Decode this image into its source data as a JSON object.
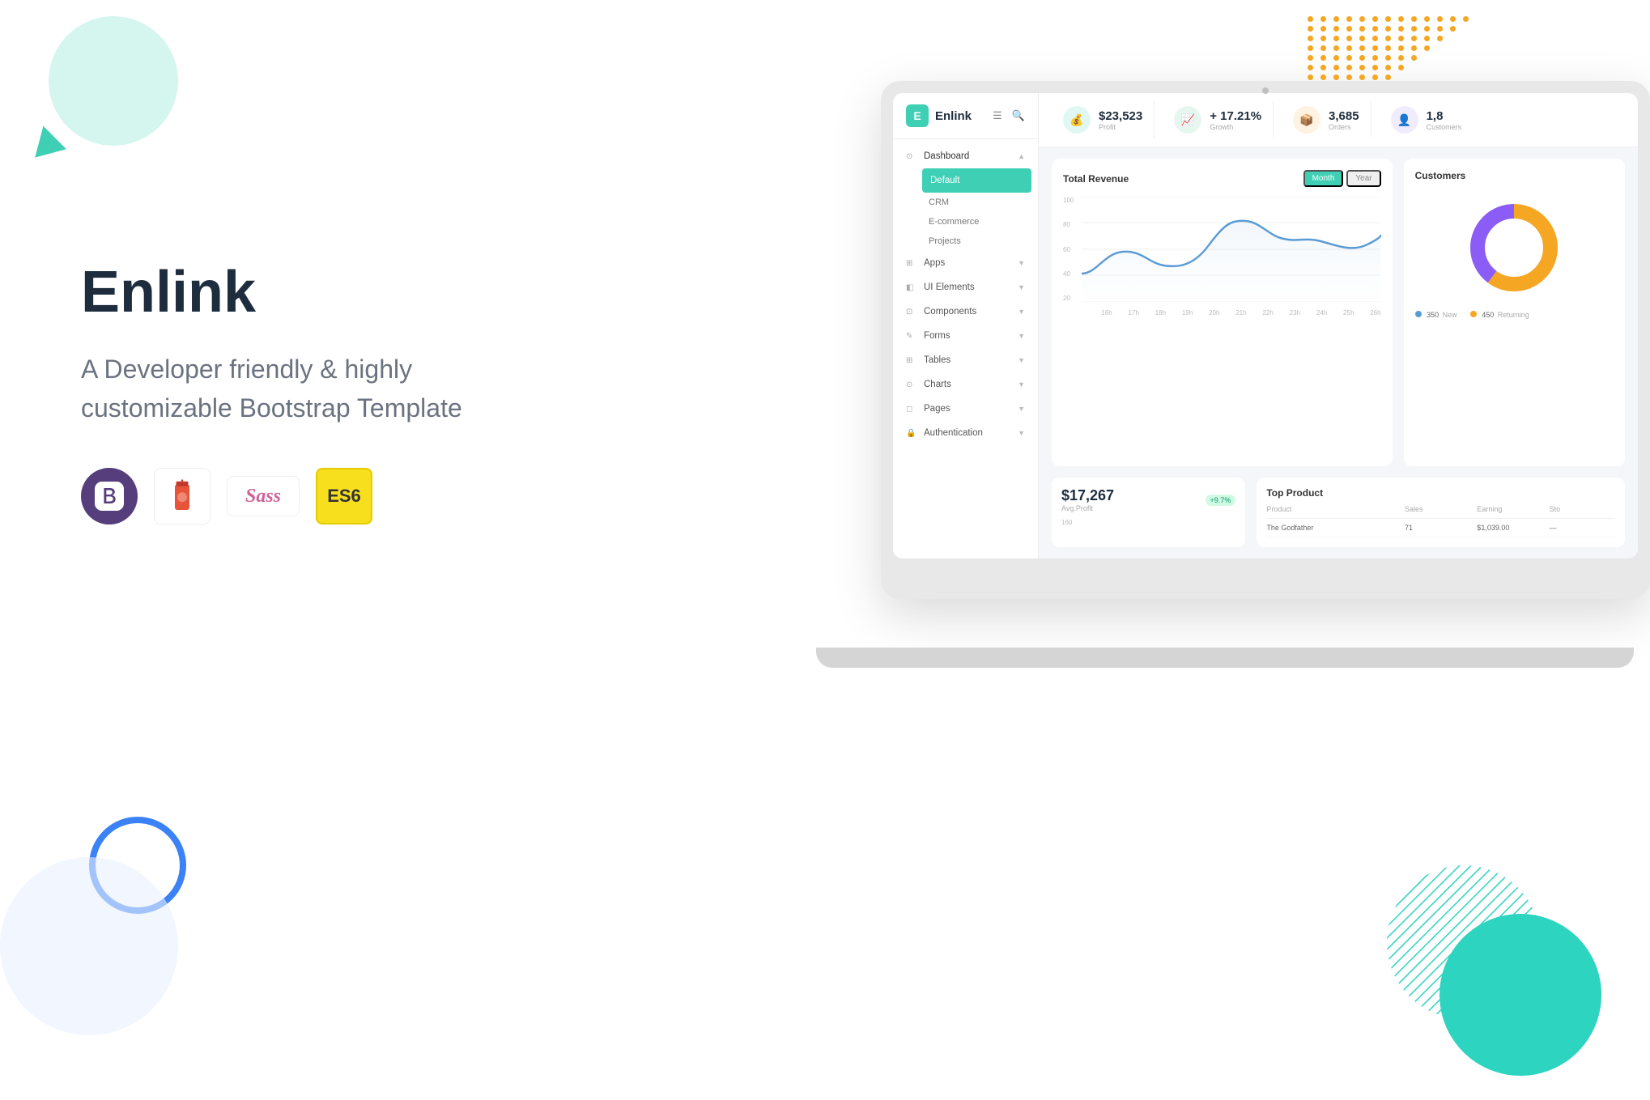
{
  "brand": {
    "name": "Enlink",
    "subtitle_line1": "A Developer friendly & highly",
    "subtitle_line2": "customizable Bootstrap Template",
    "logo_letter": "E"
  },
  "tech_badges": [
    {
      "id": "bootstrap",
      "symbol": "B",
      "color": "#563d7c",
      "text_color": "#fff"
    },
    {
      "id": "craft",
      "symbol": "🥤",
      "color": "#e8543a",
      "text_color": "#fff"
    },
    {
      "id": "sass",
      "symbol": "Sass",
      "color": "transparent",
      "text_color": "#cf649a"
    },
    {
      "id": "es6",
      "symbol": "ES6",
      "color": "#f7df1e",
      "text_color": "#333"
    }
  ],
  "dashboard": {
    "header": {
      "logo_letter": "E",
      "logo_text": "Enlink"
    },
    "sidebar": {
      "items": [
        {
          "id": "dashboard",
          "label": "Dashboard",
          "icon": "⊙",
          "has_arrow": true,
          "active_parent": true
        },
        {
          "id": "default",
          "label": "Default",
          "is_sub": true,
          "active": true
        },
        {
          "id": "crm",
          "label": "CRM",
          "is_sub": true
        },
        {
          "id": "ecommerce",
          "label": "E-commerce",
          "is_sub": true
        },
        {
          "id": "projects",
          "label": "Projects",
          "is_sub": true
        },
        {
          "id": "apps",
          "label": "Apps",
          "icon": "⬡",
          "has_arrow": true
        },
        {
          "id": "ui-elements",
          "label": "UI Elements",
          "icon": "⬡",
          "has_arrow": true
        },
        {
          "id": "components",
          "label": "Components",
          "icon": "⬡",
          "has_arrow": true
        },
        {
          "id": "forms",
          "label": "Forms",
          "icon": "⬡",
          "has_arrow": true
        },
        {
          "id": "tables",
          "label": "Tables",
          "icon": "⬡",
          "has_arrow": true
        },
        {
          "id": "charts",
          "label": "Charts",
          "icon": "⊙",
          "has_arrow": true
        },
        {
          "id": "pages",
          "label": "Pages",
          "icon": "⬡",
          "has_arrow": true
        },
        {
          "id": "authentication",
          "label": "Authentication",
          "icon": "🔒",
          "has_arrow": true
        }
      ]
    },
    "stats": [
      {
        "id": "profit",
        "value": "$23,523",
        "label": "Profit",
        "icon_color": "teal",
        "icon": "💰"
      },
      {
        "id": "growth",
        "value": "+ 17.21%",
        "label": "Growth",
        "icon_color": "green",
        "icon": "📈"
      },
      {
        "id": "orders",
        "value": "3,685",
        "label": "Orders",
        "icon_color": "orange",
        "icon": "📦"
      },
      {
        "id": "customers",
        "value": "1,8",
        "label": "Customers",
        "icon_color": "purple",
        "icon": "👤"
      }
    ],
    "total_revenue": {
      "title": "Total Revenue",
      "tab_month": "Month",
      "tab_year": "Year",
      "y_labels": [
        "100",
        "80",
        "60",
        "40",
        "20"
      ],
      "x_labels": [
        "16h",
        "17h",
        "18h",
        "19h",
        "20h",
        "21h",
        "22h",
        "23h",
        "24h",
        "25h",
        "26h"
      ]
    },
    "customers_chart": {
      "title": "Customers",
      "new_value": "350",
      "new_label": "New",
      "returning_value": "450",
      "returning_label": "Returning"
    },
    "avg_profit": {
      "value": "$17,267",
      "label": "Avg.Profit",
      "badge": "+9.7%",
      "y_value": "160"
    },
    "top_product": {
      "title": "Top Product",
      "columns": [
        "Product",
        "Sales",
        "Earning",
        "Sto"
      ]
    }
  },
  "decorative": {
    "dots_label": "yellow-dots-decoration",
    "teal_circle_label": "teal-circle-decoration",
    "blue_outline_label": "blue-outline-circle-decoration"
  }
}
